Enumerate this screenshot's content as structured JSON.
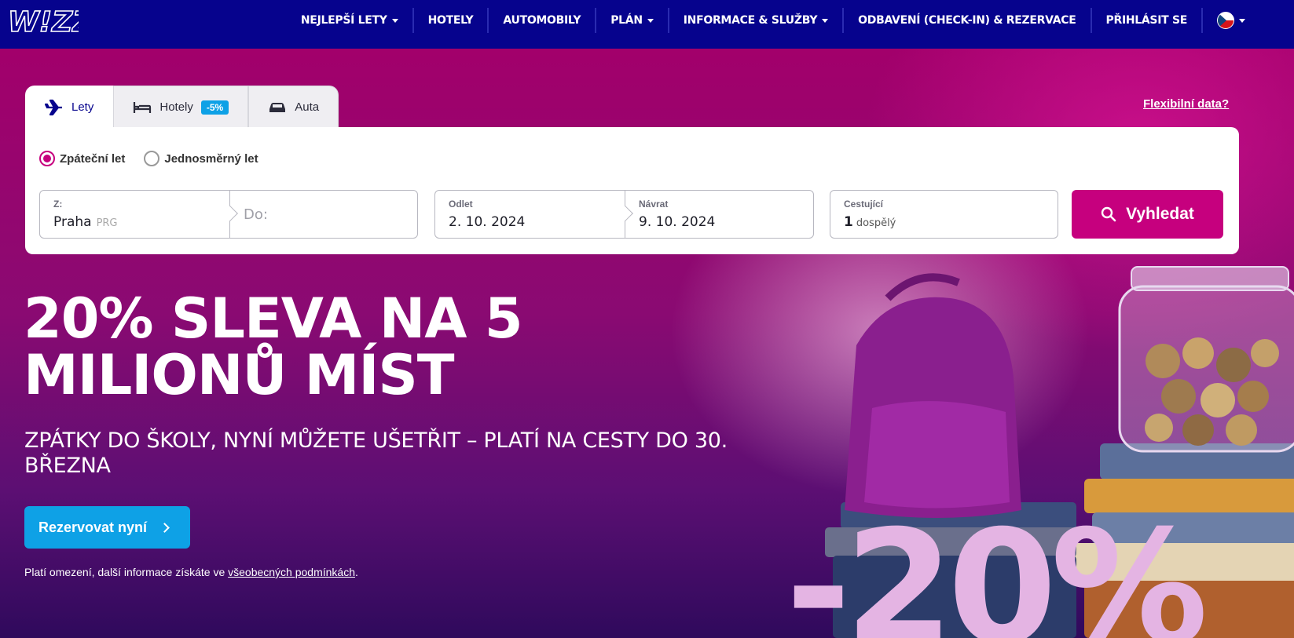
{
  "brand": {
    "logo_text": "W!ZZ"
  },
  "nav": {
    "items": [
      {
        "label": "NEJLEPŠÍ LETY",
        "dropdown": true
      },
      {
        "label": "HOTELY",
        "dropdown": false
      },
      {
        "label": "AUTOMOBILY",
        "dropdown": false
      },
      {
        "label": "PLÁN",
        "dropdown": true
      },
      {
        "label": "INFORMACE & SLUŽBY",
        "dropdown": true
      },
      {
        "label": "ODBAVENÍ (CHECK-IN) & REZERVACE",
        "dropdown": false
      },
      {
        "label": "PŘIHLÁSIT SE",
        "dropdown": false
      }
    ],
    "language": "cs"
  },
  "search": {
    "tabs": [
      {
        "label": "Lety",
        "icon": "plane-icon"
      },
      {
        "label": "Hotely",
        "icon": "bed-icon",
        "badge": "-5%"
      },
      {
        "label": "Auta",
        "icon": "car-icon"
      }
    ],
    "flexible_link": "Flexibilní data?",
    "trip_types": [
      {
        "label": "Zpáteční let",
        "checked": true
      },
      {
        "label": "Jednosměrný let",
        "checked": false
      }
    ],
    "from": {
      "label": "Z:",
      "value": "Praha",
      "code": "PRG"
    },
    "to": {
      "placeholder": "Do:"
    },
    "departure": {
      "label": "Odlet",
      "value": "2. 10. 2024"
    },
    "return": {
      "label": "Návrat",
      "value": "9. 10. 2024"
    },
    "passengers": {
      "label": "Cestující",
      "count": "1",
      "type": "dospělý"
    },
    "button_label": "Vyhledat"
  },
  "hero": {
    "headline_line1": "20% SLEVA NA 5",
    "headline_line2": "MILIONŮ MÍST",
    "subline": "ZPÁTKY DO ŠKOLY, NYNÍ MŮŽETE UŠETŘIT – PLATÍ NA CESTY DO 30. BŘEZNA",
    "cta_label": "Rezervovat nyní",
    "disclaimer_prefix": "Platí omezení, další informace získáte ve ",
    "disclaimer_link": "všeobecných podmínkách",
    "disclaimer_suffix": ".",
    "discount_graphic": "-20%"
  },
  "colors": {
    "nav_bg": "#06038d",
    "brand_magenta": "#c6007e",
    "cta_blue": "#0ea1e6"
  }
}
